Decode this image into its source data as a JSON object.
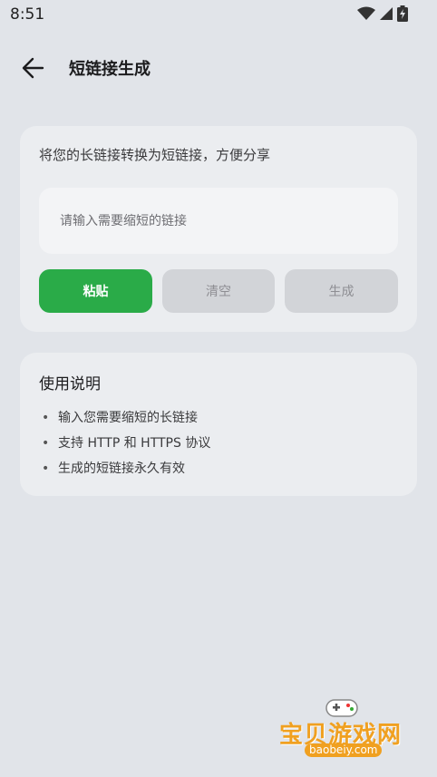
{
  "status_bar": {
    "time": "8:51"
  },
  "app_bar": {
    "title": "短链接生成"
  },
  "converter": {
    "description": "将您的长链接转换为短链接，方便分享",
    "input": {
      "value": "",
      "placeholder": "请输入需要缩短的链接"
    },
    "buttons": {
      "paste": "粘贴",
      "clear": "清空",
      "generate": "生成"
    }
  },
  "instructions": {
    "title": "使用说明",
    "bullet": "•",
    "items": [
      "输入您需要缩短的长链接",
      "支持 HTTP 和 HTTPS 协议",
      "生成的短链接永久有效"
    ]
  },
  "watermark": {
    "name": "宝贝游戏网",
    "domain": "baobeiy.com"
  },
  "colors": {
    "primary": "#2aab48",
    "background": "#e1e4e9",
    "card": "#ebedf0",
    "disabled": "#d2d4d8"
  }
}
